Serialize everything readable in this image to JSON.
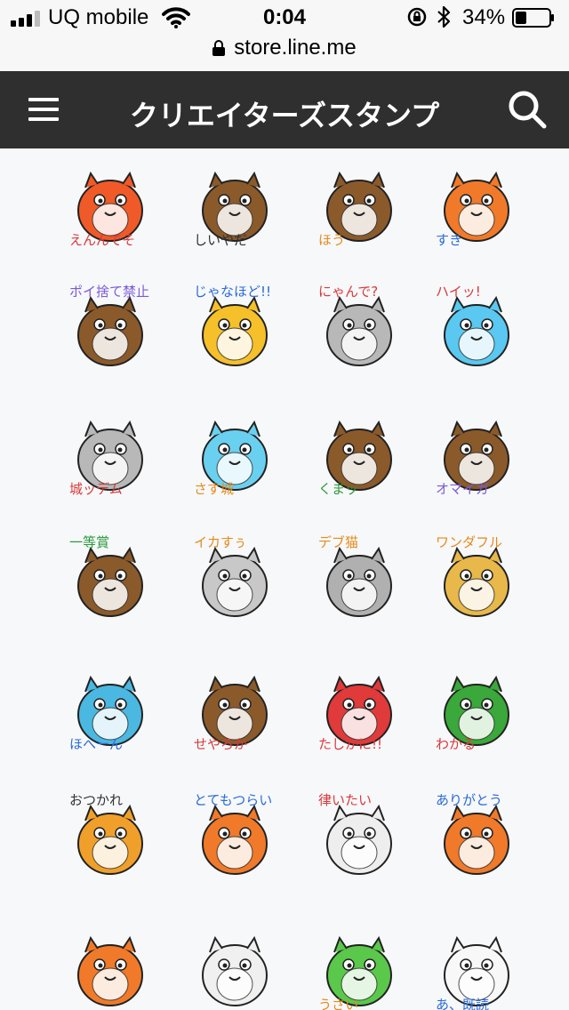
{
  "status_bar": {
    "carrier": "UQ mobile",
    "time": "0:04",
    "battery_percent": "34%",
    "battery_level": 0.34,
    "url": "store.line.me"
  },
  "nav": {
    "title": "クリエイターズスタンプ",
    "menu_icon": "hamburger-menu-icon",
    "search_icon": "search-icon"
  },
  "stickers": [
    {
      "caption": "えんんでそ",
      "creature": "orange-furry",
      "body": "#f05a28",
      "cap_color": "#d83a3a"
    },
    {
      "caption": "しいやだ",
      "creature": "beaver",
      "body": "#8b5a2b",
      "cap_color": "#333333"
    },
    {
      "caption": "ほう",
      "creature": "owl",
      "body": "#8b5a2b",
      "cap_color": "#e58a1a"
    },
    {
      "caption": "すき",
      "creature": "orange-cat",
      "body": "#f07a2a",
      "cap_color": "#2a6ad8"
    },
    {
      "caption": "ポイ捨て禁止",
      "creature": "two-bears-box",
      "body": "#8b5a2b",
      "cap_color": "#7a5ad8"
    },
    {
      "caption": "じゃなほど!!",
      "creature": "yellow-cat",
      "body": "#f5c02a",
      "cap_color": "#2a6ad8"
    },
    {
      "caption": "にゃんで?",
      "creature": "gray-cat",
      "body": "#b8b8b8",
      "cap_color": "#d83a3a"
    },
    {
      "caption": "ハイッ!",
      "creature": "blue-rabbit",
      "body": "#5ac8f0",
      "cap_color": "#d83a3a"
    },
    {
      "caption": "城ッデム",
      "creature": "gray-pigeon",
      "body": "#b8b8b8",
      "cap_color": "#d83a3a"
    },
    {
      "caption": "さす城",
      "creature": "blue-rabbit",
      "body": "#6ad0f0",
      "cap_color": "#e58a1a"
    },
    {
      "caption": "くまッ",
      "creature": "brown-bear",
      "body": "#8b5a2b",
      "cap_color": "#2a9a3a"
    },
    {
      "caption": "オマイガ",
      "creature": "moth",
      "body": "#8b5a2b",
      "cap_color": "#7a5ad8"
    },
    {
      "caption": "一等賞",
      "creature": "brown-blob",
      "body": "#8b5a2b",
      "cap_color": "#2a9a3a"
    },
    {
      "caption": "イカすぅ",
      "creature": "squid",
      "body": "#c8c8c8",
      "cap_color": "#e58a1a"
    },
    {
      "caption": "デブ猫",
      "creature": "gray-fat-cat",
      "body": "#b0b0b0",
      "cap_color": "#e58a1a"
    },
    {
      "caption": "ワンダフル",
      "creature": "yellow-dog",
      "body": "#e8b84a",
      "cap_color": "#e58a1a"
    },
    {
      "caption": "ほへーん",
      "creature": "parrot",
      "body": "#4ab8e0",
      "cap_color": "#2a6ad8"
    },
    {
      "caption": "せやろか",
      "creature": "penguin-owl",
      "body": "#8b5a2b",
      "cap_color": "#d83a3a"
    },
    {
      "caption": "たしかに!!",
      "creature": "crab",
      "body": "#e03a3a",
      "cap_color": "#e03a3a"
    },
    {
      "caption": "わかる",
      "creature": "kappa",
      "body": "#3aa83a",
      "cap_color": "#d83a3a"
    },
    {
      "caption": "おつかれ",
      "creature": "tanuki",
      "body": "#f0a02a",
      "cap_color": "#333333"
    },
    {
      "caption": "とてもつらい",
      "creature": "sleeping-orange",
      "body": "#f07a2a",
      "cap_color": "#2a6ad8"
    },
    {
      "caption": "律いたい",
      "creature": "white-ghost",
      "body": "#eeeeee",
      "cap_color": "#d83a3a"
    },
    {
      "caption": "ありがとう",
      "creature": "orange-tanuki",
      "body": "#f07a2a",
      "cap_color": "#2a6ad8"
    },
    {
      "caption": "",
      "creature": "orange-sunglasses",
      "body": "#f07a2a",
      "cap_color": "#2a6ad8"
    },
    {
      "caption": "",
      "creature": "white-raccoon",
      "body": "#f0f0f0",
      "cap_color": "#333333"
    },
    {
      "caption": "うさい",
      "creature": "green-kappa",
      "body": "#5ac84a",
      "cap_color": "#e58a1a"
    },
    {
      "caption": "あ、既読",
      "creature": "white-cat",
      "body": "#f8f8f8",
      "cap_color": "#2a6ad8"
    }
  ]
}
